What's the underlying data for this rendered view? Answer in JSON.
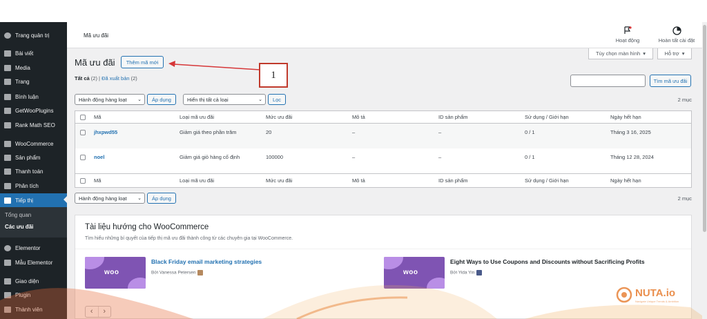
{
  "sidebar": {
    "items": [
      {
        "label": "Trang quản trị",
        "icon": "dashboard-icon"
      },
      {
        "label": "Bài viết",
        "icon": "pin-icon"
      },
      {
        "label": "Media",
        "icon": "media-icon"
      },
      {
        "label": "Trang",
        "icon": "page-icon"
      },
      {
        "label": "Bình luận",
        "icon": "comment-icon"
      },
      {
        "label": "GetWooPlugins",
        "icon": "plugin-grid-icon"
      },
      {
        "label": "Rank Math SEO",
        "icon": "chart-icon"
      },
      {
        "label": "WooCommerce",
        "icon": "woocommerce-icon"
      },
      {
        "label": "Sản phẩm",
        "icon": "archive-icon"
      },
      {
        "label": "Thanh toán",
        "icon": "payment-icon"
      },
      {
        "label": "Phân tích",
        "icon": "bar-chart-icon"
      },
      {
        "label": "Tiếp thị",
        "icon": "megaphone-icon"
      },
      {
        "label": "Elementor",
        "icon": "elementor-icon"
      },
      {
        "label": "Mẫu Elementor",
        "icon": "folder-icon"
      },
      {
        "label": "Giao diện",
        "icon": "brush-icon"
      },
      {
        "label": "Plugin",
        "icon": "plug-icon"
      },
      {
        "label": "Thành viên",
        "icon": "user-icon"
      }
    ],
    "submenu": {
      "overview": "Tổng quan",
      "coupons": "Các ưu đãi"
    }
  },
  "topbar": {
    "page_label": "Mã ưu đãi",
    "activity": "Hoạt động",
    "finish_setup": "Hoàn tất cài đặt"
  },
  "screen_options": {
    "options": "Tùy chọn màn hình",
    "help": "Hỗ trợ"
  },
  "header": {
    "title": "Mã ưu đãi",
    "add_new": "Thêm mã mới"
  },
  "filters": {
    "all": "Tất cả",
    "all_count": "(2)",
    "separator": "|",
    "drafts": "Đã xuất bản",
    "drafts_count": "(2)"
  },
  "search": {
    "placeholder": "",
    "button": "Tìm mã ưu đãi"
  },
  "bulk": {
    "action": "Hành động hàng loạt",
    "apply": "Áp dụng",
    "type_filter": "Hiển thị tất cả loại",
    "filter_button": "Lọc",
    "item_count": "2 mục"
  },
  "table": {
    "columns": [
      "Mã",
      "Loại mã ưu đãi",
      "Mức ưu đãi",
      "Mô tả",
      "ID sản phẩm",
      "Sử dụng / Giới hạn",
      "Ngày hết hạn"
    ],
    "rows": [
      {
        "code": "jhxpwd55",
        "type": "Giảm giá theo phần trăm",
        "amount": "20",
        "desc": "–",
        "product_ids": "–",
        "usage": "0 / 1",
        "expiry": "Tháng 3 16, 2025"
      },
      {
        "code": "noel",
        "type": "Giảm giá giỏ hàng cố định",
        "amount": "100000",
        "desc": "–",
        "product_ids": "–",
        "usage": "0 / 1",
        "expiry": "Tháng 12 28, 2024"
      }
    ]
  },
  "tips": {
    "title": "Tài liệu hướng cho WooCommerce",
    "subtitle": "Tìm hiểu những bí quyết của tiếp thị mã ưu đãi thành công từ các chuyên gia tại WooCommerce.",
    "articles": [
      {
        "title": "Black Friday email marketing strategies",
        "author": "Bởi Vanessa Petersen",
        "thumb_label": "woo"
      },
      {
        "title": "Eight Ways to Use Coupons and Discounts without Sacrificing Profits",
        "author": "Bởi Yida Yin",
        "thumb_label": "woo"
      }
    ],
    "prev": "‹",
    "next": "›"
  },
  "annotation": {
    "number": "1"
  },
  "watermark": {
    "brand": "NUTA.io",
    "tagline": "Navigate Unique Trends & Ambition"
  },
  "colors": {
    "accent": "#2271b1",
    "sidebar": "#1d2327",
    "arrow": "#d63638",
    "woo_purple": "#7f54b3",
    "brand_orange": "#e8833a"
  }
}
